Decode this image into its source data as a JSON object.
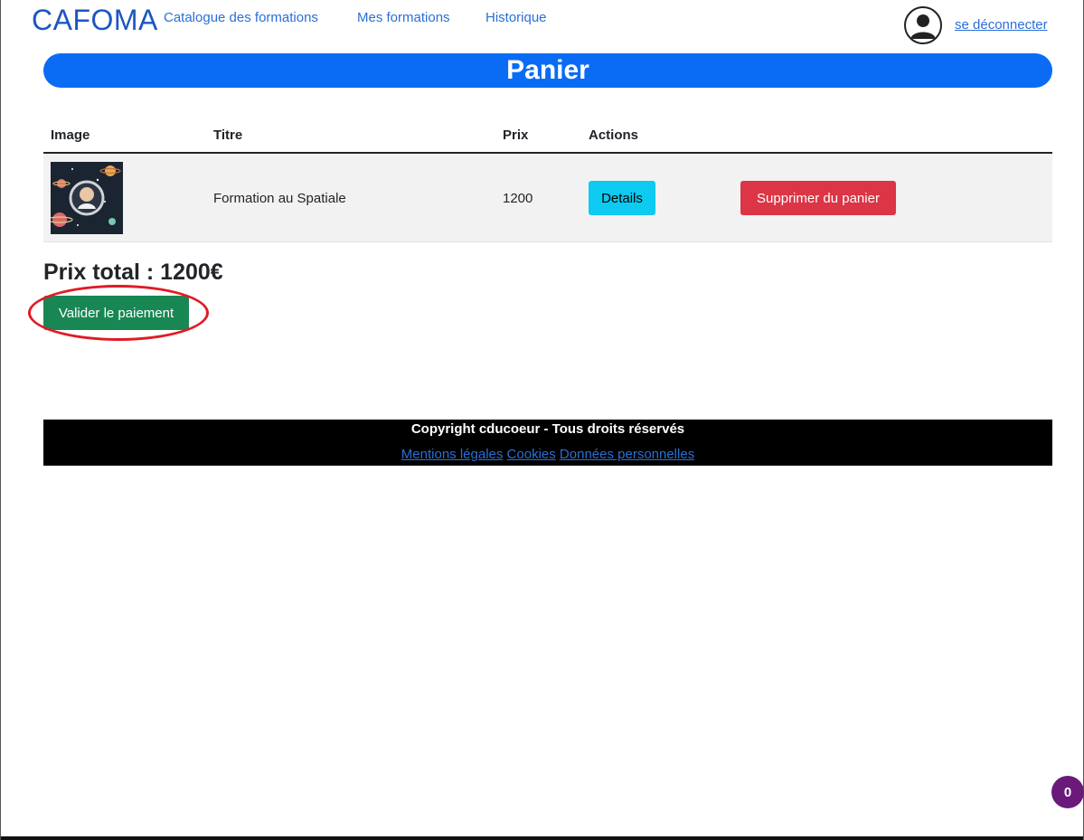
{
  "navbar": {
    "brand": "CAFOMA",
    "links": [
      "Catalogue des formations",
      "Mes formations",
      "Historique"
    ],
    "logout": "se déconnecter",
    "avatar_icon": "user-avatar-icon"
  },
  "page_title": "Panier",
  "table": {
    "headers": [
      "Image",
      "Titre",
      "Prix",
      "Actions"
    ],
    "rows": [
      {
        "image_icon": "astronaut-space-thumbnail",
        "titre": "Formation au Spatiale",
        "prix": "1200",
        "details_label": "Details",
        "remove_label": "Supprimer du panier"
      }
    ]
  },
  "total": "Prix total : 1200€",
  "pay_button": "Valider le paiement",
  "footer": {
    "copyright": "Copyright cducoeur - Tous droits réservés",
    "links": [
      "Mentions légales",
      "Cookies",
      "Données personnelles"
    ]
  },
  "badge_count": "0",
  "colors": {
    "title_bar": "#0a6cf5",
    "details": "#0dcaf0",
    "remove": "#dc3545",
    "pay": "#198754",
    "annotation": "#e01b24",
    "badge": "#6a1a7a"
  }
}
